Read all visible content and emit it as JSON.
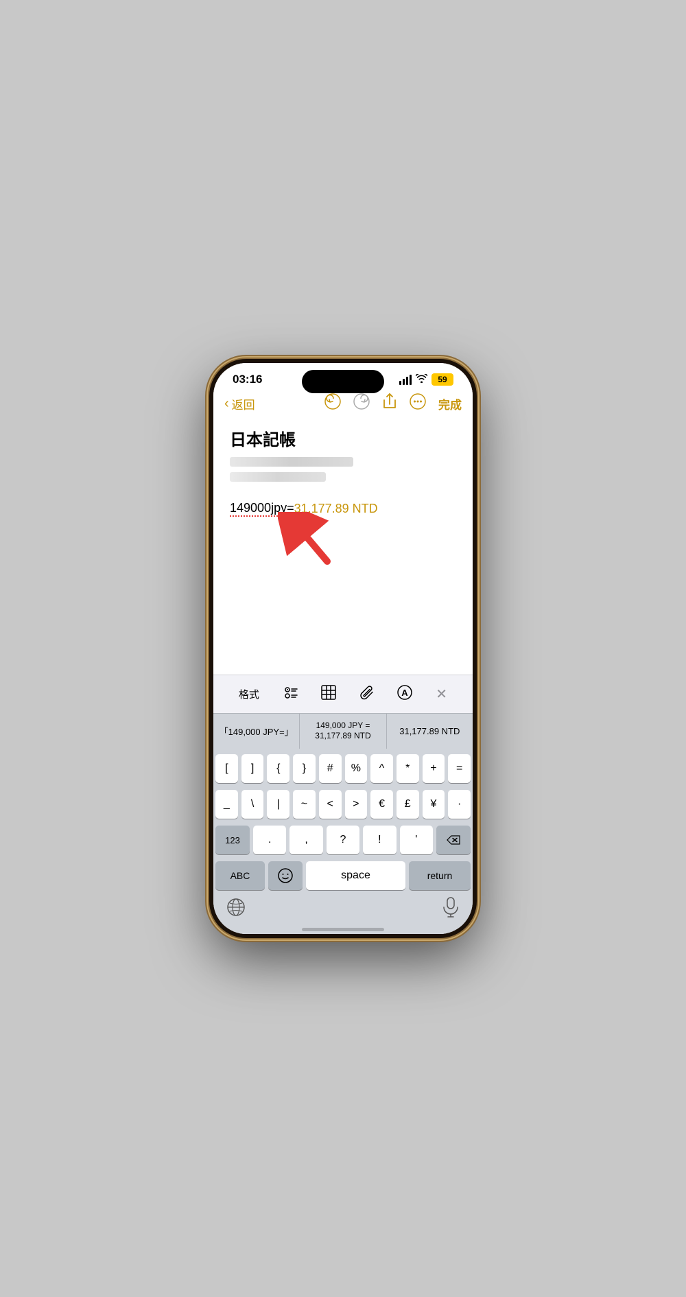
{
  "status": {
    "time": "03:16",
    "battery": "59"
  },
  "nav": {
    "back_label": "返回",
    "done_label": "完成"
  },
  "note": {
    "title": "日本記帳",
    "text_normal": "149000jpy=",
    "text_gold": "31,177.89 NTD"
  },
  "toolbar": {
    "format_label": "格式",
    "checklist_icon": "checklist",
    "table_icon": "table",
    "attachment_icon": "attachment",
    "markup_icon": "markup",
    "close_icon": "close"
  },
  "autocomplete": {
    "items": [
      "「149,000 JPY=」",
      "149,000 JPY =\n31,177.89 NTD",
      "31,177.89 NTD"
    ]
  },
  "keyboard": {
    "rows": [
      [
        "[",
        "]",
        "{",
        "}",
        "#",
        "%",
        "^",
        "*",
        "+",
        "="
      ],
      [
        "_",
        "\\",
        "|",
        "~",
        "<",
        ">",
        "€",
        "£",
        "¥",
        "·"
      ],
      [
        "123",
        ".",
        ",",
        "?",
        "!",
        "'",
        "⌫"
      ]
    ],
    "bottom": {
      "abc": "ABC",
      "space": "space",
      "return": "return"
    }
  }
}
